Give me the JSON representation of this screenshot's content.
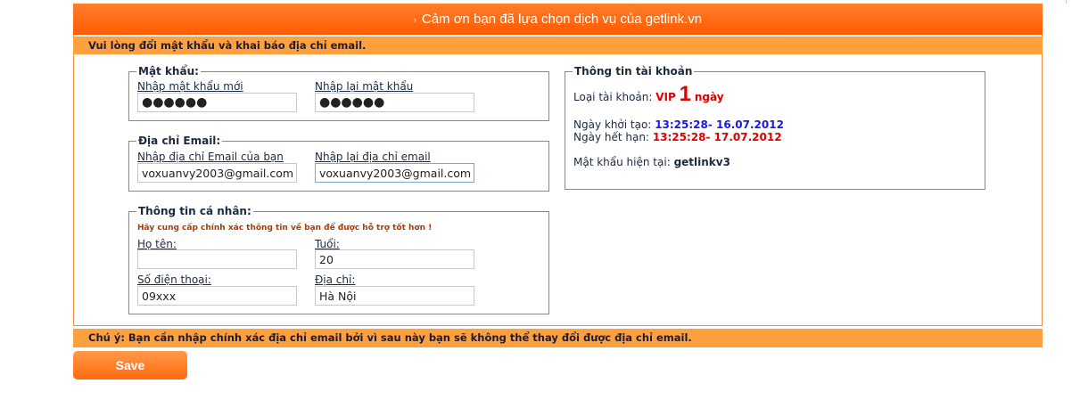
{
  "header": {
    "arrow": "›",
    "title": "Cảm ơn bạn đã lựa chọn dịch vụ của getlink.vn",
    "subtitle": "Vui lòng đổi mật khẩu và khai báo địa chỉ email."
  },
  "password_section": {
    "legend": "Mật khẩu:",
    "new_label": "Nhập mật khẩu mới",
    "new_value": "●●●●●●",
    "confirm_label": "Nhập lại mật khẩu",
    "confirm_value": "●●●●●●"
  },
  "email_section": {
    "legend": "Địa chỉ Email:",
    "email_label": "Nhập địa chỉ Email của bạn",
    "email_value": "voxuanvy2003@gmail.com",
    "confirm_label": "Nhập lại địa chỉ email",
    "confirm_value": "voxuanvy2003@gmail.com"
  },
  "personal_section": {
    "legend": "Thông tin cá nhân:",
    "hint": "Hãy cung cấp chính xác thông tin về bạn để được hỗ trợ tốt hơn !",
    "name_label": "Họ tên:",
    "name_value": "",
    "age_label": "Tuổi:",
    "age_value": "20",
    "phone_label": "Số điện thoại:",
    "phone_value": "09xxx",
    "address_label": "Địa chỉ:",
    "address_value": "Hà Nội"
  },
  "account_section": {
    "legend": "Thông tin tài khoản",
    "type_label": "Loại tài khoản:",
    "type_vip": "VIP",
    "type_days": "1",
    "type_unit": "ngày",
    "created_label": "Ngày khởi tạo:",
    "created_value": "13:25:28- 16.07.2012",
    "expire_label": "Ngày hết hạn:",
    "expire_value": "13:25:28- 17.07.2012",
    "password_label": "Mật khẩu hiện tại:",
    "password_value": "getlinkv3"
  },
  "note": "Chú ý: Bạn cần nhập chính xác địa chỉ email bởi vì sau này bạn sẽ không thể thay đổi được địa chỉ email.",
  "save_label": "Save",
  "colors": {
    "header_orange": "#ff5a00",
    "bar_orange": "#ffa03e",
    "vip_red": "#e00000",
    "date_blue": "#1a1ad8"
  }
}
